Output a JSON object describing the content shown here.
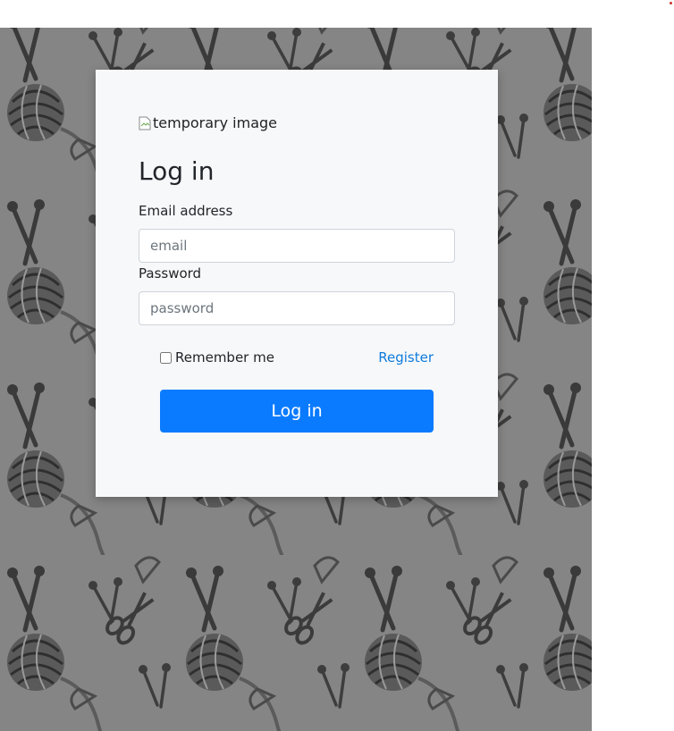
{
  "image_alt": "temporary image",
  "login": {
    "title": "Log in",
    "email_label": "Email address",
    "email_placeholder": "email",
    "email_value": "",
    "password_label": "Password",
    "password_placeholder": "password",
    "password_value": "",
    "remember_label": "Remember me",
    "remember_checked": false,
    "register_label": "Register",
    "submit_label": "Log in"
  },
  "colors": {
    "background_pattern": "#858585",
    "card": "#f7f8fa",
    "primary": "#0a7bff",
    "link": "#0d7bdc"
  },
  "icons": {
    "background": "knitting-pattern-icon",
    "broken_image": "broken-image-icon"
  }
}
